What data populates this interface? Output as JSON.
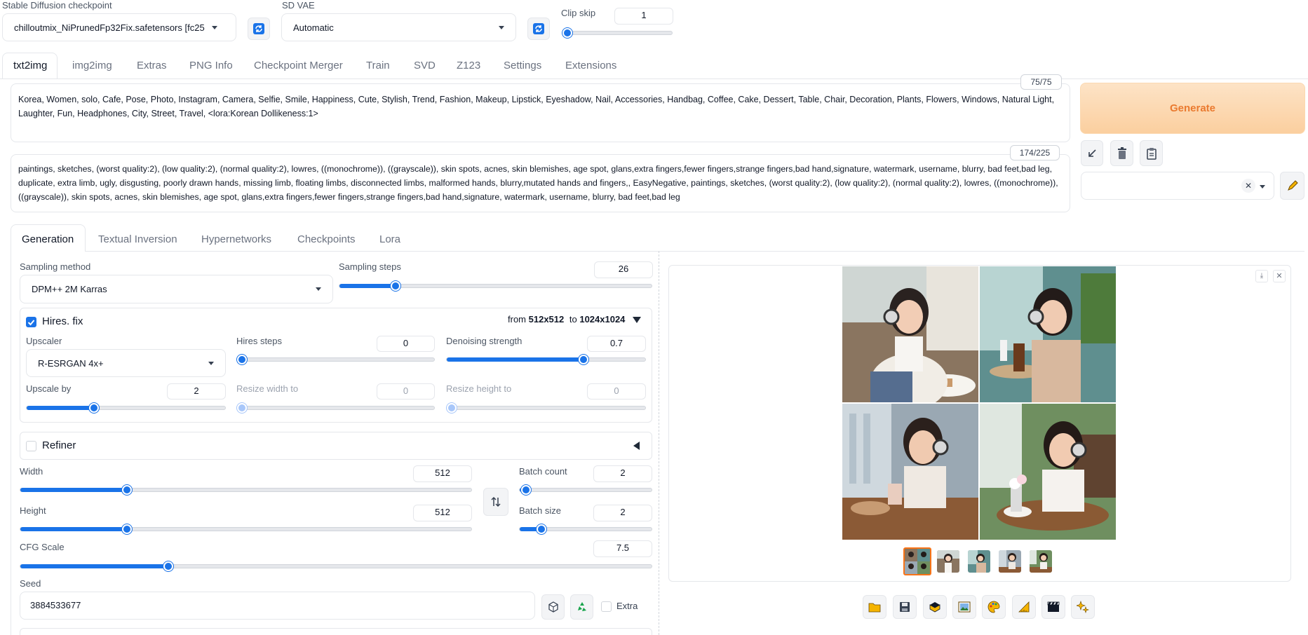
{
  "header": {
    "checkpoint_label": "Stable Diffusion checkpoint",
    "checkpoint_value": "chilloutmix_NiPrunedFp32Fix.safetensors [fc25",
    "vae_label": "SD VAE",
    "vae_value": "Automatic",
    "clip_skip_label": "Clip skip",
    "clip_skip_value": "1",
    "clip_skip_fraction": 0.0
  },
  "top_tabs": [
    "txt2img",
    "img2img",
    "Extras",
    "PNG Info",
    "Checkpoint Merger",
    "Train",
    "SVD",
    "Z123",
    "Settings",
    "Extensions"
  ],
  "prompt": {
    "counter": "75/75",
    "text": "Korea, Women, solo, Cafe, Pose, Photo, Instagram, Camera, Selfie, Smile, Happiness, Cute, Stylish, Trend, Fashion, Makeup, Lipstick, Eyeshadow, Nail, Accessories, Handbag, Coffee, Cake, Dessert, Table, Chair, Decoration, Plants, Flowers, Windows, Natural Light, Laughter, Fun, Headphones, City, Street, Travel, <lora:Korean Dollikeness:1>"
  },
  "negative_prompt": {
    "counter": "174/225",
    "text": "paintings, sketches, (worst quality:2), (low quality:2), (normal quality:2), lowres, ((monochrome)), ((grayscale)), skin spots, acnes, skin blemishes, age spot, glans,extra fingers,fewer fingers,strange fingers,bad hand,signature, watermark, username, blurry, bad feet,bad leg, duplicate, extra limb, ugly, disgusting, poorly drawn hands, missing limb, floating limbs, disconnected limbs, malformed hands, blurry,mutated hands and fingers,, EasyNegative, paintings, sketches, (worst quality:2), (low quality:2), (normal quality:2), lowres, ((monochrome)), ((grayscale)), skin spots, acnes, skin blemishes, age spot, glans,extra fingers,fewer fingers,strange fingers,bad hand,signature, watermark, username, blurry, bad feet,bad leg"
  },
  "generate_label": "Generate",
  "sub_tabs": [
    "Generation",
    "Textual Inversion",
    "Hypernetworks",
    "Checkpoints",
    "Lora"
  ],
  "sampling": {
    "method_label": "Sampling method",
    "method_value": "DPM++ 2M Karras",
    "steps_label": "Sampling steps",
    "steps_value": "26",
    "steps_fraction": 0.17
  },
  "hires": {
    "label": "Hires. fix",
    "checked": true,
    "from_prefix": "from",
    "from_size": "512x512",
    "to_prefix": "to",
    "to_size": "1024x1024",
    "upscaler_label": "Upscaler",
    "upscaler_value": "R-ESRGAN 4x+",
    "steps_label": "Hires steps",
    "steps_value": "0",
    "steps_fraction": 0.0,
    "denoise_label": "Denoising strength",
    "denoise_value": "0.7",
    "denoise_fraction": 0.7,
    "upscale_by_label": "Upscale by",
    "upscale_by_value": "2",
    "upscale_by_fraction": 0.33,
    "resize_w_label": "Resize width to",
    "resize_w_value": "0",
    "resize_h_label": "Resize height to",
    "resize_h_value": "0"
  },
  "refiner": {
    "label": "Refiner",
    "checked": false
  },
  "dims": {
    "width_label": "Width",
    "width_value": "512",
    "width_fraction": 0.23,
    "height_label": "Height",
    "height_value": "512",
    "height_fraction": 0.23,
    "batch_count_label": "Batch count",
    "batch_count_value": "2",
    "batch_count_fraction": 0.01,
    "batch_size_label": "Batch size",
    "batch_size_value": "2",
    "batch_size_fraction": 0.14
  },
  "cfg": {
    "label": "CFG Scale",
    "value": "7.5",
    "fraction": 0.23
  },
  "seed": {
    "label": "Seed",
    "value": "3884533677",
    "extra_label": "Extra"
  },
  "colors": {
    "accent": "#1a73e8",
    "generate_bg": "#fdd9b5",
    "generate_text": "#ea7a2f"
  },
  "output_tools": [
    "folder-icon",
    "save-icon",
    "zip-icon",
    "image-icon",
    "palette-icon",
    "ruler-icon",
    "film-icon",
    "sparkle-icon"
  ]
}
